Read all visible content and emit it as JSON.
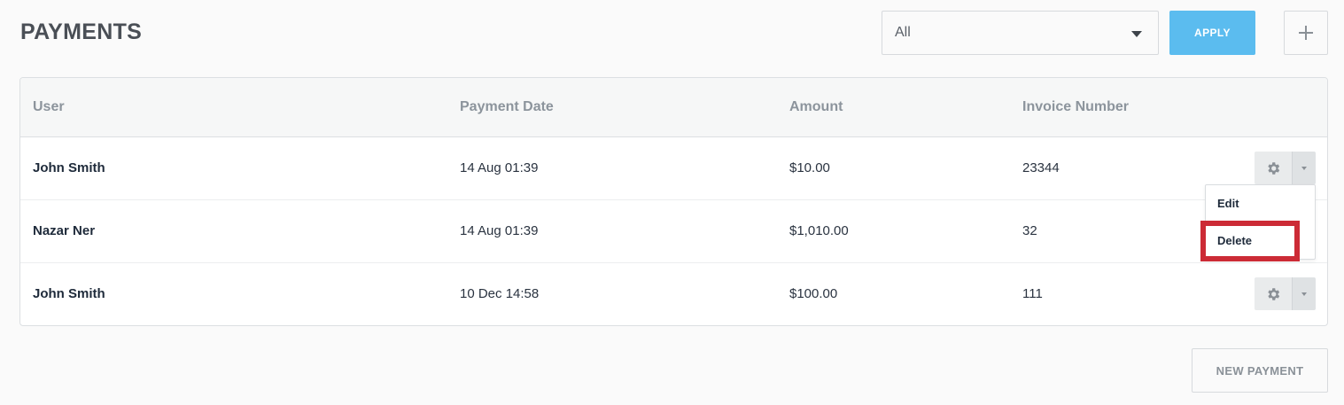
{
  "header": {
    "title": "PAYMENTS",
    "filter": {
      "selected": "All",
      "icon": "chevron-down-icon"
    },
    "apply_label": "APPLY",
    "add_icon": "plus-icon"
  },
  "table": {
    "columns": [
      "User",
      "Payment Date",
      "Amount",
      "Invoice Number"
    ],
    "rows": [
      {
        "user": "John Smith",
        "payment_date": "14 Aug 01:39",
        "amount": "$10.00",
        "invoice_number": "23344"
      },
      {
        "user": "Nazar Ner",
        "payment_date": "14 Aug 01:39",
        "amount": "$1,010.00",
        "invoice_number": "32"
      },
      {
        "user": "John Smith",
        "payment_date": "10 Dec 14:58",
        "amount": "$100.00",
        "invoice_number": "111"
      }
    ]
  },
  "row_menu": {
    "items": [
      "Edit",
      "Delete"
    ],
    "highlighted": "Delete"
  },
  "footer": {
    "new_payment_label": "NEW PAYMENT"
  },
  "colors": {
    "accent": "#5bbcef",
    "highlight": "#cc2b36"
  }
}
